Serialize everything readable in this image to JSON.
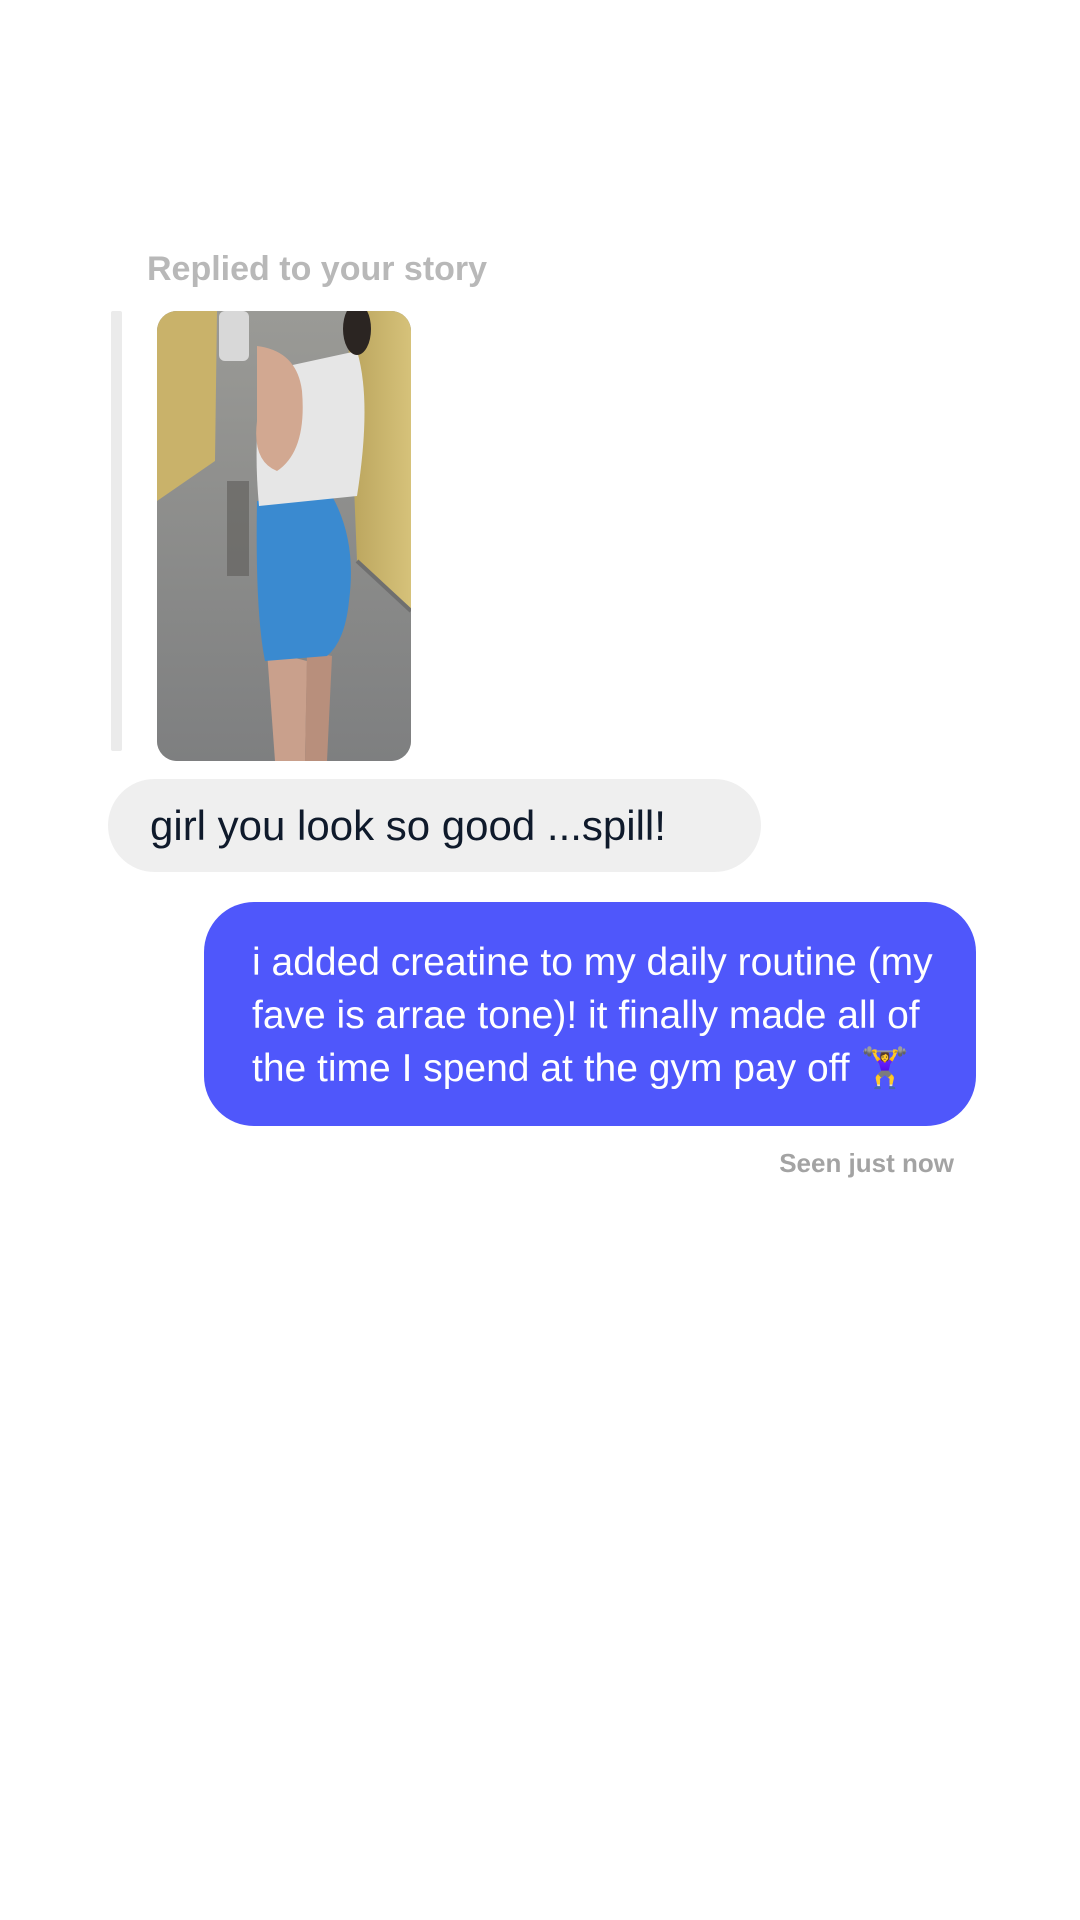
{
  "story_reply": {
    "label": "Replied to your story",
    "image_alt": "story photo: mirror selfie in white tank top and blue shorts"
  },
  "messages": [
    {
      "direction": "incoming",
      "text": "girl you look so good ...spill!"
    },
    {
      "direction": "outgoing",
      "text": "i added creatine to my daily routine (my\nfave is arrae tone)! it finally made all of\nthe time I spend at the gym pay off 🏋️‍♀️"
    }
  ],
  "status": {
    "seen_text": "Seen just now"
  },
  "colors": {
    "outgoing_bubble": "#4f57fb",
    "incoming_bubble": "#efefef",
    "meta_text": "#a3a3a3"
  }
}
